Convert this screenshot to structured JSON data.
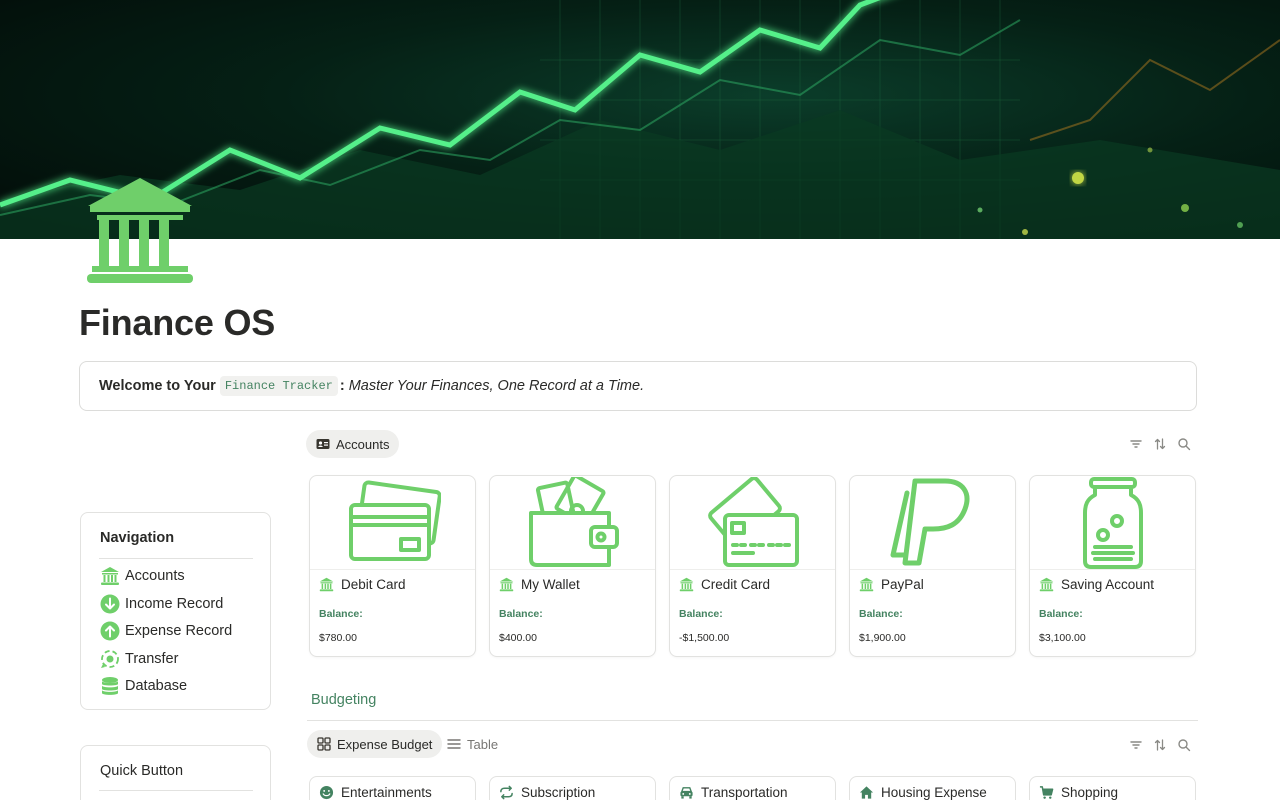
{
  "page": {
    "title": "Finance OS",
    "icon": "bank-icon"
  },
  "callout": {
    "lead": "Welcome to Your",
    "code": "Finance Tracker",
    "colon": ":",
    "tagline": "Master Your Finances, One Record at a Time."
  },
  "navigation": {
    "title": "Navigation",
    "items": [
      {
        "label": "Accounts",
        "icon": "bank-icon"
      },
      {
        "label": "Income Record",
        "icon": "arrow-down-circle-icon"
      },
      {
        "label": "Expense Record",
        "icon": "arrow-up-circle-icon"
      },
      {
        "label": "Transfer",
        "icon": "transfer-icon"
      },
      {
        "label": "Database",
        "icon": "database-icon"
      }
    ]
  },
  "quick": {
    "title": "Quick Button"
  },
  "accounts": {
    "tab_label": "Accounts",
    "balance_label": "Balance:",
    "cards": [
      {
        "name": "Debit Card",
        "balance": "$780.00",
        "cover": "cards-icon"
      },
      {
        "name": "My Wallet",
        "balance": "$400.00",
        "cover": "wallet-icon"
      },
      {
        "name": "Credit Card",
        "balance": "-$1,500.00",
        "cover": "credit-card-icon"
      },
      {
        "name": "PayPal",
        "balance": "$1,900.00",
        "cover": "paypal-icon"
      },
      {
        "name": "Saving Account",
        "balance": "$3,100.00",
        "cover": "coin-jar-icon"
      }
    ]
  },
  "budgeting": {
    "heading": "Budgeting",
    "tabs": [
      {
        "label": "Expense Budget",
        "active": true
      },
      {
        "label": "Table",
        "active": false
      }
    ],
    "cards": [
      {
        "name": "Entertainments",
        "icon": "smile-icon"
      },
      {
        "name": "Subscription",
        "icon": "repeat-icon"
      },
      {
        "name": "Transportation",
        "icon": "car-icon"
      },
      {
        "name": "Housing Expense",
        "icon": "house-icon"
      },
      {
        "name": "Shopping",
        "icon": "cart-icon"
      }
    ]
  },
  "colors": {
    "accent_green": "#6fcf6a",
    "text_green": "#448361"
  }
}
